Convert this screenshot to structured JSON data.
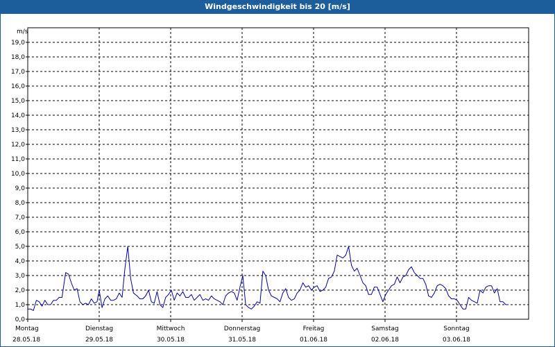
{
  "title": "Windgeschwindigkeit bis 20 [m/s]",
  "colors": {
    "titlebar": "#1c5e9c",
    "line": "#0000a0",
    "grid": "#000000"
  },
  "chart_data": {
    "type": "line",
    "title": "Windgeschwindigkeit bis 20 [m/s]",
    "ylabel": "m/s",
    "xlabel": "",
    "ylim": [
      0,
      20
    ],
    "yticks": [
      "0,0",
      "1,0",
      "2,0",
      "3,0",
      "4,0",
      "5,0",
      "6,0",
      "7,0",
      "8,0",
      "9,0",
      "10,0",
      "11,0",
      "12,0",
      "13,0",
      "14,0",
      "15,0",
      "16,0",
      "17,0",
      "18,0",
      "19,0"
    ],
    "grid": true,
    "days": [
      {
        "day": "Montag",
        "date": "28.05.18"
      },
      {
        "day": "Dienstag",
        "date": "29.05.18"
      },
      {
        "day": "Mittwoch",
        "date": "30.05.18"
      },
      {
        "day": "Donnerstag",
        "date": "31.05.18"
      },
      {
        "day": "Freitag",
        "date": "01.06.18"
      },
      {
        "day": "Samstag",
        "date": "02.06.18"
      },
      {
        "day": "Sonntag",
        "date": "03.06.18"
      }
    ],
    "x_unit": "days since Montag 28.05.18 00:00",
    "x_range": [
      0,
      7
    ],
    "series": [
      {
        "name": "",
        "points": [
          [
            0.0,
            0.7
          ],
          [
            0.04,
            0.7
          ],
          [
            0.08,
            0.6
          ],
          [
            0.12,
            1.3
          ],
          [
            0.16,
            1.2
          ],
          [
            0.2,
            0.9
          ],
          [
            0.24,
            1.3
          ],
          [
            0.28,
            1.0
          ],
          [
            0.32,
            1.0
          ],
          [
            0.36,
            1.3
          ],
          [
            0.4,
            1.3
          ],
          [
            0.44,
            1.5
          ],
          [
            0.48,
            1.5
          ],
          [
            0.53,
            3.2
          ],
          [
            0.57,
            3.1
          ],
          [
            0.61,
            2.5
          ],
          [
            0.65,
            2.0
          ],
          [
            0.69,
            2.1
          ],
          [
            0.73,
            1.2
          ],
          [
            0.77,
            1.0
          ],
          [
            0.81,
            1.1
          ],
          [
            0.85,
            1.0
          ],
          [
            0.89,
            1.4
          ],
          [
            0.93,
            1.1
          ],
          [
            0.97,
            1.2
          ],
          [
            1.0,
            2.0
          ],
          [
            1.04,
            0.8
          ],
          [
            1.08,
            1.4
          ],
          [
            1.12,
            1.6
          ],
          [
            1.16,
            1.3
          ],
          [
            1.2,
            1.3
          ],
          [
            1.24,
            1.4
          ],
          [
            1.28,
            1.8
          ],
          [
            1.32,
            1.5
          ],
          [
            1.36,
            3.5
          ],
          [
            1.4,
            5.0
          ],
          [
            1.44,
            2.8
          ],
          [
            1.48,
            1.8
          ],
          [
            1.53,
            1.6
          ],
          [
            1.57,
            1.4
          ],
          [
            1.61,
            1.4
          ],
          [
            1.65,
            1.6
          ],
          [
            1.69,
            2.0
          ],
          [
            1.73,
            1.2
          ],
          [
            1.77,
            1.1
          ],
          [
            1.81,
            1.9
          ],
          [
            1.85,
            1.0
          ],
          [
            1.89,
            0.8
          ],
          [
            1.93,
            1.5
          ],
          [
            1.97,
            1.7
          ],
          [
            2.01,
            2.0
          ],
          [
            2.05,
            1.3
          ],
          [
            2.09,
            1.8
          ],
          [
            2.13,
            1.6
          ],
          [
            2.17,
            1.9
          ],
          [
            2.21,
            1.5
          ],
          [
            2.25,
            1.5
          ],
          [
            2.29,
            1.7
          ],
          [
            2.33,
            1.3
          ],
          [
            2.37,
            1.5
          ],
          [
            2.41,
            1.7
          ],
          [
            2.45,
            1.3
          ],
          [
            2.49,
            1.4
          ],
          [
            2.53,
            1.3
          ],
          [
            2.57,
            1.6
          ],
          [
            2.61,
            1.4
          ],
          [
            2.65,
            1.3
          ],
          [
            2.69,
            1.2
          ],
          [
            2.73,
            1.0
          ],
          [
            2.77,
            1.6
          ],
          [
            2.81,
            1.8
          ],
          [
            2.85,
            1.9
          ],
          [
            2.89,
            1.8
          ],
          [
            2.93,
            1.3
          ],
          [
            2.97,
            2.2
          ],
          [
            3.01,
            3.0
          ],
          [
            3.05,
            1.0
          ],
          [
            3.09,
            0.8
          ],
          [
            3.13,
            0.7
          ],
          [
            3.17,
            0.9
          ],
          [
            3.21,
            1.2
          ],
          [
            3.25,
            1.1
          ],
          [
            3.29,
            3.3
          ],
          [
            3.33,
            3.0
          ],
          [
            3.37,
            2.0
          ],
          [
            3.41,
            1.6
          ],
          [
            3.45,
            1.5
          ],
          [
            3.49,
            1.4
          ],
          [
            3.53,
            1.2
          ],
          [
            3.57,
            1.8
          ],
          [
            3.61,
            2.1
          ],
          [
            3.65,
            1.5
          ],
          [
            3.69,
            1.3
          ],
          [
            3.73,
            1.4
          ],
          [
            3.77,
            1.8
          ],
          [
            3.81,
            2.0
          ],
          [
            3.85,
            2.5
          ],
          [
            3.89,
            2.2
          ],
          [
            3.93,
            2.3
          ],
          [
            3.97,
            2.0
          ],
          [
            4.01,
            2.2
          ],
          [
            4.05,
            2.3
          ],
          [
            4.09,
            1.9
          ],
          [
            4.13,
            2.0
          ],
          [
            4.17,
            2.2
          ],
          [
            4.21,
            2.8
          ],
          [
            4.25,
            2.9
          ],
          [
            4.29,
            3.3
          ],
          [
            4.33,
            4.4
          ],
          [
            4.37,
            4.3
          ],
          [
            4.41,
            4.2
          ],
          [
            4.45,
            4.4
          ],
          [
            4.49,
            5.0
          ],
          [
            4.53,
            3.7
          ],
          [
            4.57,
            3.3
          ],
          [
            4.61,
            3.5
          ],
          [
            4.65,
            3.0
          ],
          [
            4.69,
            2.5
          ],
          [
            4.73,
            2.3
          ],
          [
            4.77,
            1.7
          ],
          [
            4.81,
            1.7
          ],
          [
            4.85,
            2.2
          ],
          [
            4.89,
            2.2
          ],
          [
            4.93,
            1.7
          ],
          [
            4.97,
            1.2
          ],
          [
            5.01,
            1.7
          ],
          [
            5.05,
            2.0
          ],
          [
            5.09,
            2.3
          ],
          [
            5.13,
            2.4
          ],
          [
            5.17,
            2.9
          ],
          [
            5.21,
            2.5
          ],
          [
            5.25,
            2.9
          ],
          [
            5.29,
            3.0
          ],
          [
            5.33,
            3.4
          ],
          [
            5.37,
            3.6
          ],
          [
            5.41,
            3.2
          ],
          [
            5.45,
            3.0
          ],
          [
            5.49,
            2.8
          ],
          [
            5.53,
            2.8
          ],
          [
            5.57,
            2.4
          ],
          [
            5.61,
            1.6
          ],
          [
            5.65,
            1.5
          ],
          [
            5.69,
            1.8
          ],
          [
            5.73,
            2.3
          ],
          [
            5.77,
            2.4
          ],
          [
            5.81,
            2.3
          ],
          [
            5.85,
            2.1
          ],
          [
            5.89,
            1.6
          ],
          [
            5.93,
            1.4
          ],
          [
            5.97,
            1.4
          ],
          [
            6.01,
            1.3
          ],
          [
            6.05,
            1.0
          ],
          [
            6.09,
            0.7
          ],
          [
            6.13,
            0.7
          ],
          [
            6.17,
            1.5
          ],
          [
            6.21,
            1.3
          ],
          [
            6.25,
            1.2
          ],
          [
            6.29,
            1.1
          ],
          [
            6.33,
            2.0
          ],
          [
            6.37,
            1.8
          ],
          [
            6.41,
            2.2
          ],
          [
            6.45,
            2.3
          ],
          [
            6.49,
            2.3
          ],
          [
            6.53,
            1.8
          ],
          [
            6.57,
            2.1
          ],
          [
            6.61,
            1.2
          ],
          [
            6.65,
            1.2
          ],
          [
            6.69,
            1.0
          ],
          [
            6.73,
            1.0
          ]
        ]
      }
    ]
  }
}
